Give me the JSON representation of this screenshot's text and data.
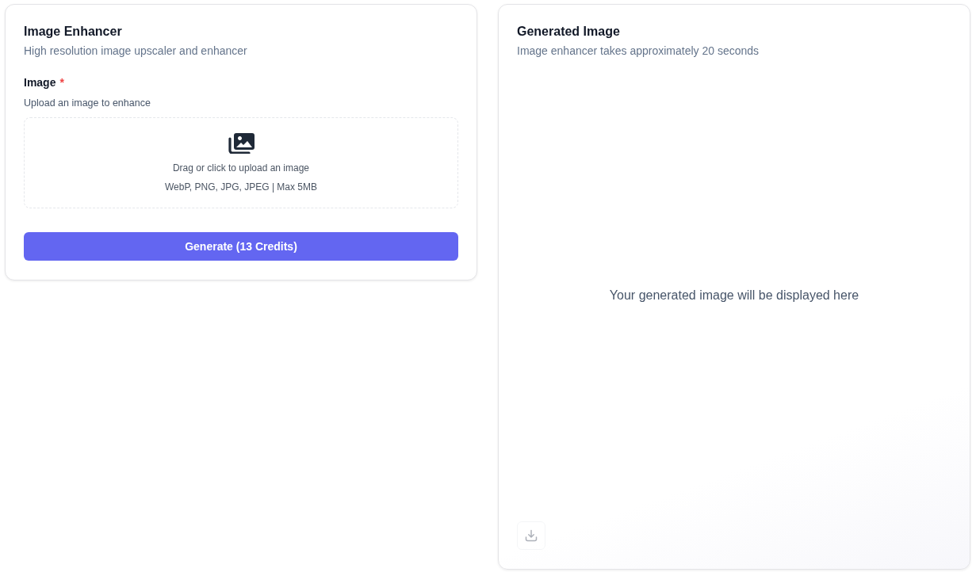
{
  "enhancer_card": {
    "title": "Image Enhancer",
    "subtitle": "High resolution image upscaler and enhancer",
    "image_field": {
      "label": "Image",
      "required_mark": "*",
      "hint": "Upload an image to enhance",
      "dropzone": {
        "prompt": "Drag or click to upload an image",
        "formats": "WebP, PNG, JPG, JPEG | Max 5MB"
      }
    },
    "generate_button": {
      "label": "Generate (13 Credits)"
    }
  },
  "result_card": {
    "title": "Generated Image",
    "subtitle": "Image enhancer takes approximately 20 seconds",
    "placeholder": "Your generated image will be displayed here",
    "download_button": {
      "disabled": true
    }
  }
}
